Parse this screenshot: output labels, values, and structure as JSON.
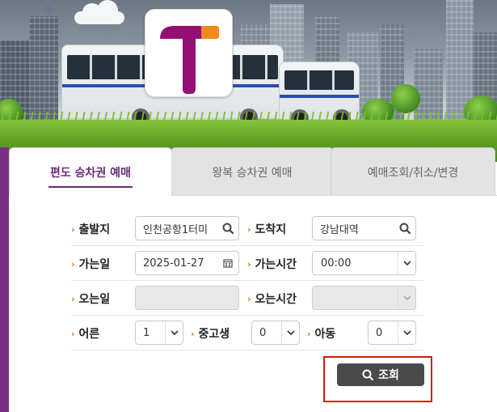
{
  "tabs": [
    {
      "label": "편도 승차권 예매",
      "active": true
    },
    {
      "label": "왕복 승차권 예매",
      "active": false
    },
    {
      "label": "예매조회/취소/변경",
      "active": false
    }
  ],
  "form": {
    "departure": {
      "label": "출발지",
      "value": "인천공항1터미"
    },
    "arrival": {
      "label": "도착지",
      "value": "강남대역"
    },
    "depart_date": {
      "label": "가는일",
      "value": "2025-01-27"
    },
    "depart_time": {
      "label": "가는시간",
      "value": "00:00"
    },
    "return_date": {
      "label": "오는일",
      "value": ""
    },
    "return_time": {
      "label": "오는시간",
      "value": ""
    },
    "adult": {
      "label": "어른",
      "value": "1"
    },
    "youth": {
      "label": "중고생",
      "value": "0"
    },
    "child": {
      "label": "아동",
      "value": "0"
    }
  },
  "search_button": {
    "label": "조회",
    "icon": "search-icon"
  },
  "colors": {
    "accent_purple": "#7a3185",
    "arrow_orange": "#d96b1a",
    "button_dark": "#4a4a4a",
    "highlight_red": "#e01515"
  }
}
